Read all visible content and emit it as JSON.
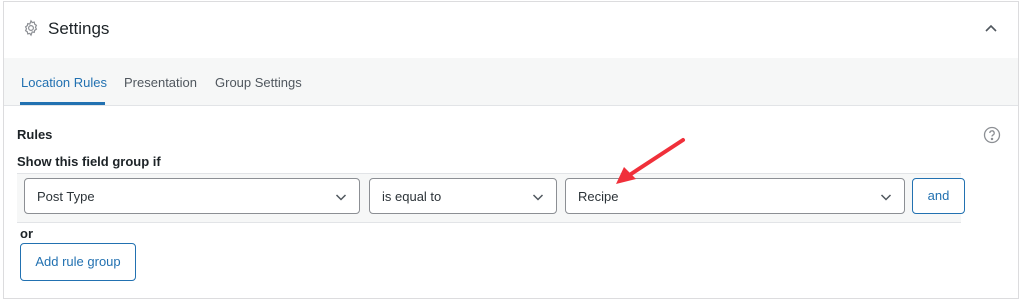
{
  "header": {
    "title": "Settings",
    "icon": "gear-icon",
    "collapse_icon": "chevron-up-icon"
  },
  "tabs": [
    {
      "label": "Location Rules",
      "active": true
    },
    {
      "label": "Presentation",
      "active": false
    },
    {
      "label": "Group Settings",
      "active": false
    }
  ],
  "rules": {
    "heading": "Rules",
    "subheading": "Show this field group if",
    "help_icon": "help-icon",
    "row": {
      "param": "Post Type",
      "operator": "is equal to",
      "value": "Recipe",
      "and_label": "and"
    },
    "or_label": "or",
    "add_group_label": "Add rule group"
  },
  "colors": {
    "accent": "#2271b1",
    "annotation_arrow": "#f0303a"
  }
}
